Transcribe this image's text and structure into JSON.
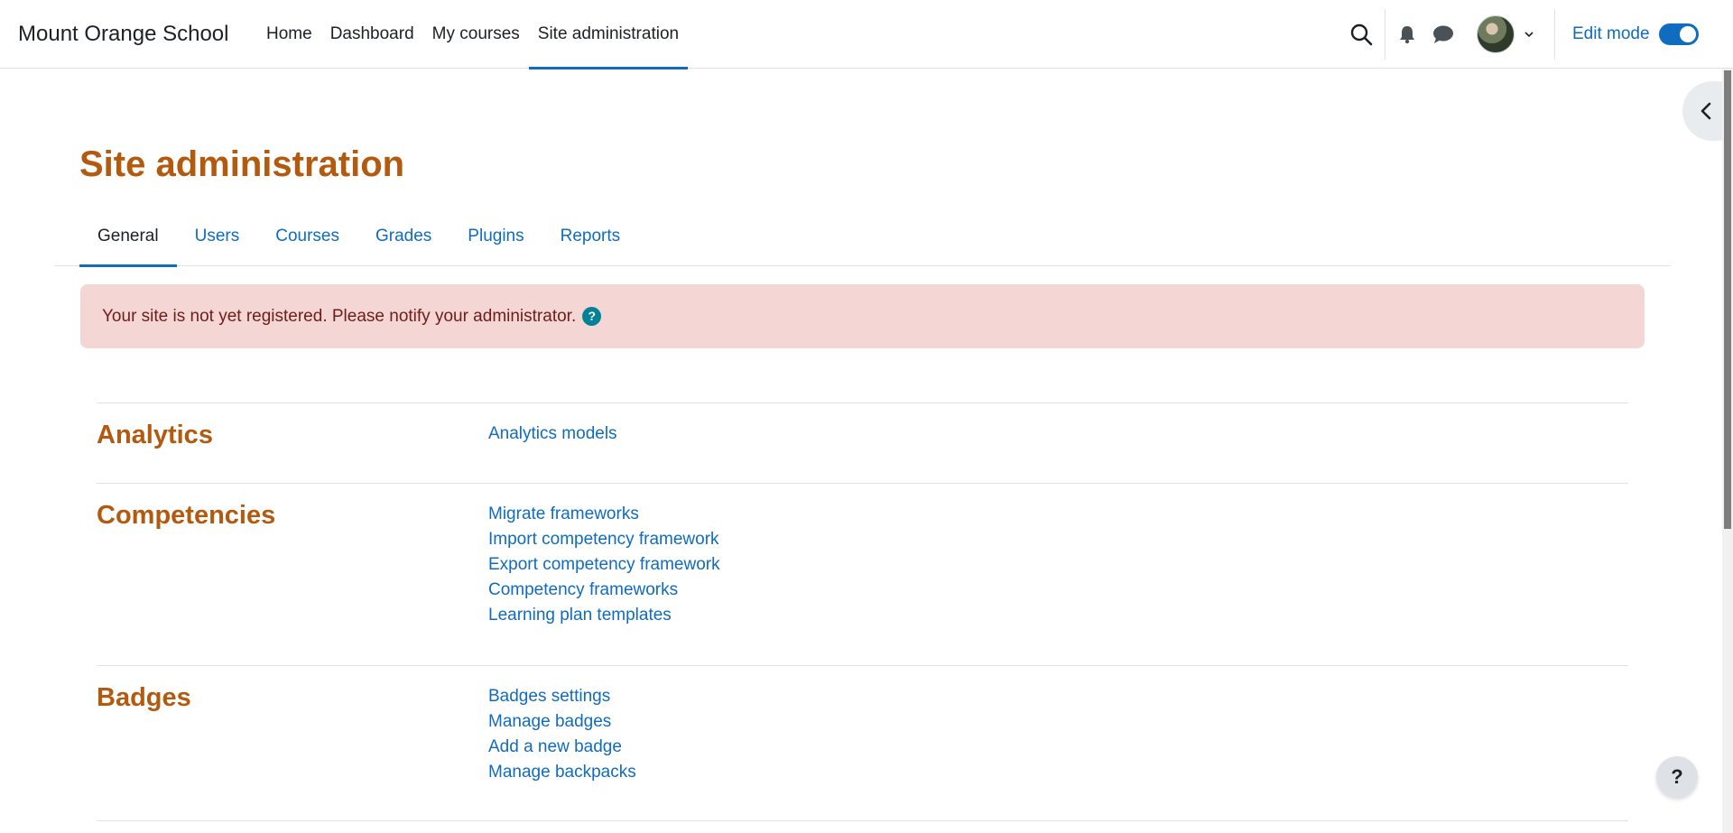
{
  "brand": {
    "name": "Mount Orange School"
  },
  "primary_nav": [
    {
      "label": "Home"
    },
    {
      "label": "Dashboard"
    },
    {
      "label": "My courses"
    },
    {
      "label": "Site administration",
      "active": true
    }
  ],
  "user_nav": {
    "icons": [
      "search-icon",
      "bell-icon",
      "chat-icon",
      "chevron-down-icon"
    ],
    "edit_mode_label": "Edit mode",
    "edit_mode_on": true
  },
  "page": {
    "title": "Site administration"
  },
  "tabs": [
    {
      "label": "General",
      "active": true
    },
    {
      "label": "Users"
    },
    {
      "label": "Courses"
    },
    {
      "label": "Grades"
    },
    {
      "label": "Plugins"
    },
    {
      "label": "Reports"
    }
  ],
  "alert": {
    "text": "Your site is not yet registered. Please notify your administrator.",
    "help_glyph": "?"
  },
  "categories": [
    {
      "title": "Analytics",
      "links": [
        "Analytics models"
      ]
    },
    {
      "title": "Competencies",
      "links": [
        "Migrate frameworks",
        "Import competency framework",
        "Export competency framework",
        "Competency frameworks",
        "Learning plan templates"
      ]
    },
    {
      "title": "Badges",
      "links": [
        "Badges settings",
        "Manage badges",
        "Add a new badge",
        "Manage backpacks"
      ]
    }
  ],
  "floating_help": {
    "glyph": "?"
  },
  "colors": {
    "accent": "#0f6cbf",
    "heading": "#b35a0f",
    "alert_bg": "#f4d6d4",
    "alert_text": "#6e1d1a",
    "help_bg": "#008196"
  }
}
